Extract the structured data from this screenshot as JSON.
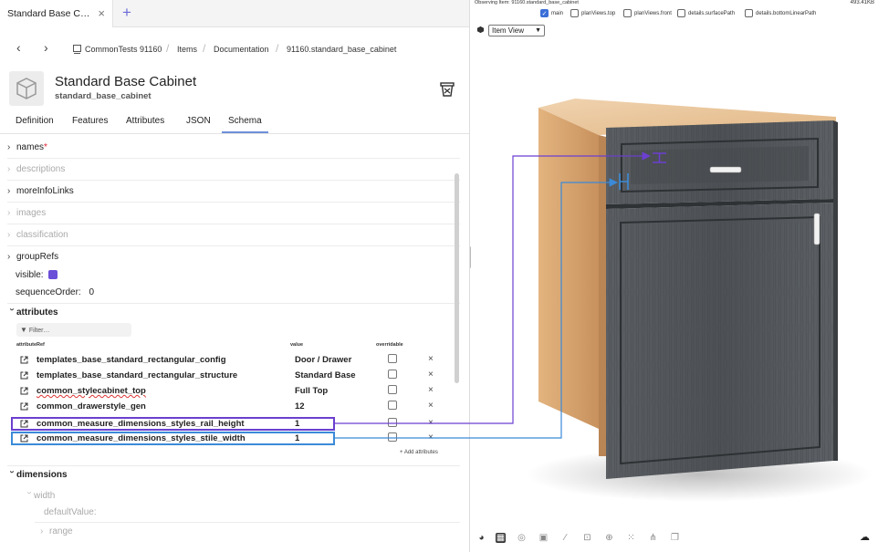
{
  "tab": {
    "title": "Standard Base C…",
    "close": "×",
    "add": "+"
  },
  "breadcrumb": {
    "back": "‹",
    "forward": "›",
    "items": [
      "CommonTests 91160",
      "Items",
      "Documentation",
      "91160.standard_base_cabinet"
    ]
  },
  "header": {
    "title": "Standard Base Cabinet",
    "subtitle": "standard_base_cabinet"
  },
  "section_tabs": [
    "Definition",
    "Features",
    "Attributes",
    "JSON",
    "Schema"
  ],
  "schema": {
    "names": "names",
    "names_required": "*",
    "descriptions": "descriptions",
    "moreInfoLinks": "moreInfoLinks",
    "images": "images",
    "classification": "classification",
    "groupRefs": "groupRefs",
    "visible_label": "visible:",
    "visible_color": "#6b4fd8",
    "sequence_label": "sequenceOrder:",
    "sequence_value": "0",
    "attributes_label": "attributes",
    "filter_placeholder": "Filter…",
    "columns": {
      "ref": "attributeRef",
      "value": "value",
      "overridable": "overridable"
    },
    "rows": [
      {
        "name": "templates_base_standard_rectangular_config",
        "value": "Door / Drawer"
      },
      {
        "name": "templates_base_standard_rectangular_structure",
        "value": "Standard Base"
      },
      {
        "name": "common_stylecabinet_top",
        "value": "Full Top"
      },
      {
        "name": "common_drawerstyle_gen",
        "value": "12"
      },
      {
        "name": "common_measure_dimensions_styles_rail_height",
        "value": "1"
      },
      {
        "name": "common_measure_dimensions_styles_stile_width",
        "value": "1"
      }
    ],
    "delete_glyph": "×",
    "add_attributes": "+ Add attributes",
    "dimensions_label": "dimensions",
    "width_label": "width",
    "default_value_label": "defaultValue:",
    "range_label": "range"
  },
  "viewer": {
    "observing": "Observing Item: 91160.standard_base_cabinet",
    "memory": "493.41KB",
    "views": [
      {
        "label": "main",
        "checked": true
      },
      {
        "label": "planViews.top",
        "checked": false
      },
      {
        "label": "planViews.front",
        "checked": false
      },
      {
        "label": "details.surfacePath",
        "checked": false
      },
      {
        "label": "details.bottomLinearPath",
        "checked": false
      }
    ],
    "view_select": "Item View",
    "colors": {
      "rail": "#6b3fd0",
      "stile": "#3b8ad8",
      "box": "#d9a673",
      "door": "#55595d"
    }
  }
}
